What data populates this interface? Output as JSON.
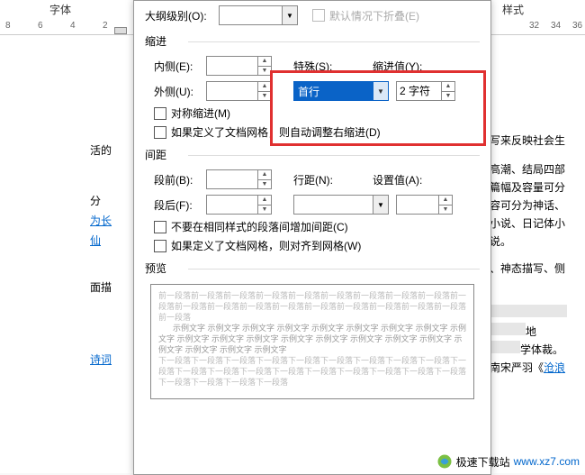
{
  "header": {
    "font_group": "字体",
    "style_group": "样式"
  },
  "ruler_left": [
    "8",
    "6",
    "4",
    "2"
  ],
  "ruler_right": [
    "32",
    "34",
    "36"
  ],
  "dialog": {
    "outline_label": "大纲级别(O):",
    "collapse_label": "默认情况下折叠(E)",
    "indent_title": "缩进",
    "inside_label": "内侧(E):",
    "outside_label": "外侧(U):",
    "special_label": "特殊(S):",
    "indent_value_label": "缩进值(Y):",
    "special_selected": "首行",
    "indent_value": "2 字符",
    "mirror_label": "对称缩进(M)",
    "grid_adjust_label": "如果定义了文档网格，则自动调整右缩进(D)",
    "spacing_title": "间距",
    "before_label": "段前(B):",
    "after_label": "段后(F):",
    "line_spacing_label": "行距(N):",
    "set_value_label": "设置值(A):",
    "no_space_label": "不要在相同样式的段落间增加间距(C)",
    "snap_grid_label": "如果定义了文档网格，则对齐到网格(W)",
    "preview_title": "预览",
    "preview_gray1": "前一段落前一段落前一段落前一段落前一段落前一段落前一段落前一段落前一段落前一段落前一段落前一段落前一段落前一段落前一段落前一段落前一段落前一段落前一段落前一段落",
    "preview_sample": "示例文字 示例文字 示例文字 示例文字 示例文字 示例文字 示例文字 示例文字 示例文字 示例文字 示例文字 示例文字 示例文字 示例文字 示例文字 示例文字 示例文字 示例文字 示例文字 示例文字 示例文字",
    "preview_gray2": "下一段落下一段落下一段落下一段落下一段落下一段落下一段落下一段落下一段落下一段落下一段落下一段落下一段落下一段落下一段落下一段落下一段落下一段落下一段落下一段落下一段落下一段落下一段落"
  },
  "doc_left": {
    "t1": "活的",
    "t2": "分",
    "t3": "为",
    "t4": "仙",
    "t5": "面描",
    "t6": "诗词"
  },
  "doc_right": {
    "l1": "写来反映社会生",
    "l2": "高潮、结局四部",
    "l3": "篇幅及容量可分",
    "l4": "容可分为神话、",
    "l5": "小说、日记体小",
    "l6": "说。",
    "l7": "、神态描写、侧",
    "l8": "地",
    "l9": "学体裁。",
    "l10a": "南宋严羽《",
    "l10b": "沧浪"
  },
  "watermark": {
    "text": "极速下载站",
    "url": "www.xz7.com"
  }
}
